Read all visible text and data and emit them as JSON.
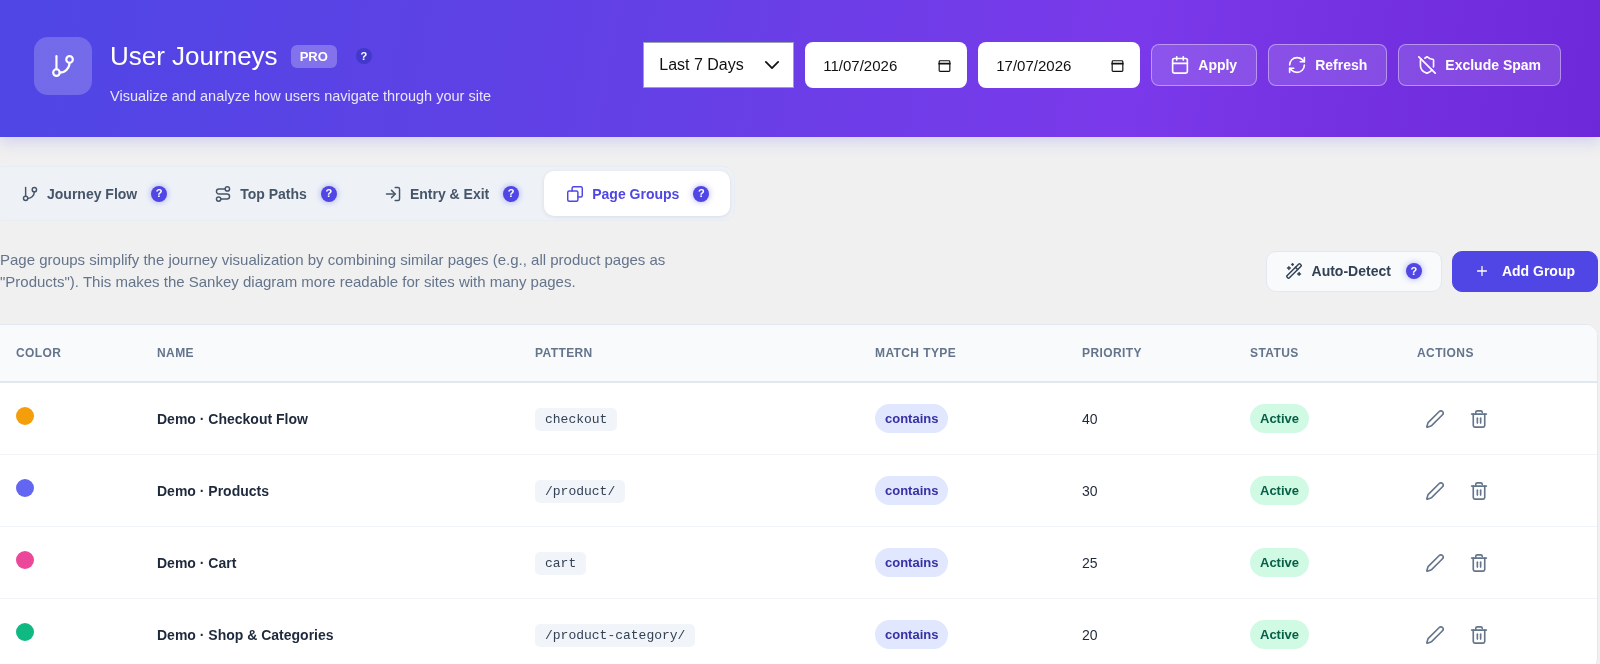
{
  "header": {
    "title": "User Journeys",
    "badge": "PRO",
    "help": "?",
    "subtitle": "Visualize and analyze how users navigate through your site",
    "period_select": {
      "value": "Last 7 Days"
    },
    "start_date": {
      "value": "11/07/2026"
    },
    "end_date": {
      "value": "17/07/2026"
    },
    "buttons": [
      {
        "label": "Apply"
      },
      {
        "label": "Refresh"
      },
      {
        "label": "Exclude Spam"
      }
    ]
  },
  "tabs": [
    {
      "label": "Journey Flow",
      "help": "?",
      "selected": false
    },
    {
      "label": "Top Paths",
      "help": "?",
      "selected": false
    },
    {
      "label": "Entry & Exit",
      "help": "?",
      "selected": false
    },
    {
      "label": "Page Groups",
      "help": "?",
      "selected": true
    }
  ],
  "description": "Page groups simplify the journey visualization by combining similar pages (e.g., all product pages as \"Products\"). This makes the Sankey diagram more readable for sites with many pages.",
  "actions": [
    {
      "label": "Auto-Detect",
      "kind": "secondary",
      "help": "?"
    },
    {
      "label": "Add Group",
      "kind": "primary"
    }
  ],
  "table": {
    "columns": [
      "COLOR",
      "NAME",
      "PATTERN",
      "MATCH TYPE",
      "PRIORITY",
      "STATUS",
      "ACTIONS"
    ],
    "rows": [
      {
        "color": "#f59e0b",
        "name": "Demo · Checkout Flow",
        "pattern": "checkout",
        "match_type": "contains",
        "priority": "40",
        "status": "Active"
      },
      {
        "color": "#6366f1",
        "name": "Demo · Products",
        "pattern": "/product/",
        "match_type": "contains",
        "priority": "30",
        "status": "Active"
      },
      {
        "color": "#ec4899",
        "name": "Demo · Cart",
        "pattern": "cart",
        "match_type": "contains",
        "priority": "25",
        "status": "Active"
      },
      {
        "color": "#10b981",
        "name": "Demo · Shop & Categories",
        "pattern": "/product-category/",
        "match_type": "contains",
        "priority": "20",
        "status": "Active"
      }
    ]
  }
}
